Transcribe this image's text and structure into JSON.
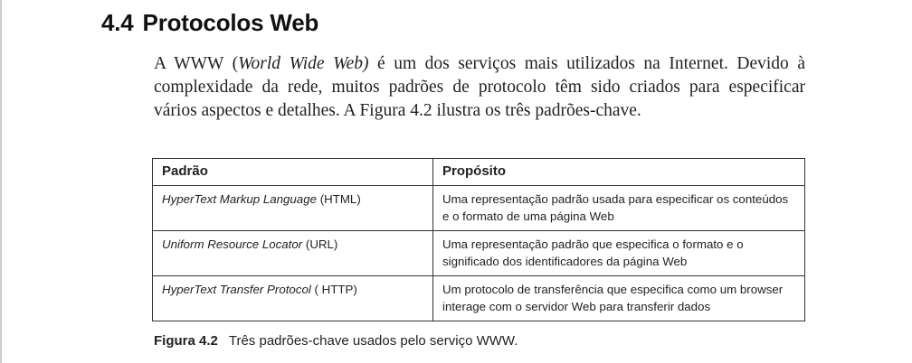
{
  "section": {
    "number": "4.4",
    "title": "Protocolos Web"
  },
  "paragraph": {
    "line1_before": "A WWW (",
    "line1_italic": "World Wide Web)",
    "line1_after": " é um dos serviços mais utilizados na Internet. Devido à",
    "line2": "complexidade da rede, muitos padrões de protocolo têm sido criados para especificar",
    "line3": "vários aspectos e detalhes. A Figura 4.2 ilustra os três padrões-chave."
  },
  "table": {
    "headers": [
      "Padrão",
      "Propósito"
    ],
    "rows": [
      {
        "standard_italic": "HyperText Markup Language",
        "standard_suffix": " (HTML)",
        "purpose": "Uma representação padrão usada para especificar os conteúdos e o formato de uma página Web"
      },
      {
        "standard_italic": "Uniform Resource Locator",
        "standard_suffix": " (URL)",
        "purpose": "Uma representação padrão que especifica o formato e o significado dos identificadores da página Web"
      },
      {
        "standard_italic": "HyperText Transfer Protocol",
        "standard_suffix": " ( HTTP)",
        "purpose": "Um protocolo de transferência que especifica como um browser interage com o servidor Web para transferir dados"
      }
    ]
  },
  "caption": {
    "label": "Figura 4.2",
    "text": "Três padrões-chave usados pelo serviço WWW."
  }
}
